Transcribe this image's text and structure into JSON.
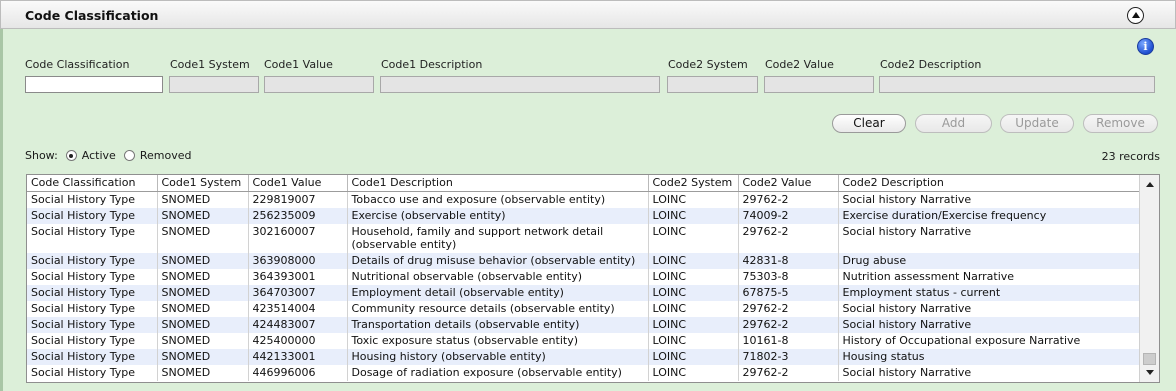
{
  "panel": {
    "title": "Code Classification"
  },
  "form": {
    "labels": {
      "code_classification": "Code Classification",
      "code1_system": "Code1 System",
      "code1_value": "Code1 Value",
      "code1_description": "Code1 Description",
      "code2_system": "Code2 System",
      "code2_value": "Code2 Value",
      "code2_description": "Code2 Description"
    },
    "values": {
      "code_classification": "",
      "code1_system": "",
      "code1_value": "",
      "code1_description": "",
      "code2_system": "",
      "code2_value": "",
      "code2_description": ""
    }
  },
  "buttons": {
    "clear": "Clear",
    "add": "Add",
    "update": "Update",
    "remove": "Remove"
  },
  "filter": {
    "show_label": "Show:",
    "active_label": "Active",
    "removed_label": "Removed",
    "selected": "Active"
  },
  "records_count": "23 records",
  "grid": {
    "columns": [
      "Code Classification",
      "Code1 System",
      "Code1 Value",
      "Code1 Description",
      "Code2 System",
      "Code2 Value",
      "Code2 Description"
    ],
    "rows": [
      [
        "Social History Type",
        "SNOMED",
        "229819007",
        "Tobacco use and exposure (observable entity)",
        "LOINC",
        "29762-2",
        "Social history Narrative"
      ],
      [
        "Social History Type",
        "SNOMED",
        "256235009",
        "Exercise (observable entity)",
        "LOINC",
        "74009-2",
        "Exercise duration/Exercise frequency"
      ],
      [
        "Social History Type",
        "SNOMED",
        "302160007",
        "Household, family and support network detail (observable entity)",
        "LOINC",
        "29762-2",
        "Social history Narrative"
      ],
      [
        "Social History Type",
        "SNOMED",
        "363908000",
        "Details of drug misuse behavior (observable entity)",
        "LOINC",
        "42831-8",
        "Drug abuse"
      ],
      [
        "Social History Type",
        "SNOMED",
        "364393001",
        "Nutritional observable (observable entity)",
        "LOINC",
        "75303-8",
        "Nutrition assessment Narrative"
      ],
      [
        "Social History Type",
        "SNOMED",
        "364703007",
        "Employment detail (observable entity)",
        "LOINC",
        "67875-5",
        "Employment status - current"
      ],
      [
        "Social History Type",
        "SNOMED",
        "423514004",
        "Community resource details (observable entity)",
        "LOINC",
        "29762-2",
        "Social history Narrative"
      ],
      [
        "Social History Type",
        "SNOMED",
        "424483007",
        "Transportation details (observable entity)",
        "LOINC",
        "29762-2",
        "Social history Narrative"
      ],
      [
        "Social History Type",
        "SNOMED",
        "425400000",
        "Toxic exposure status (observable entity)",
        "LOINC",
        "10161-8",
        "History of Occupational exposure Narrative"
      ],
      [
        "Social History Type",
        "SNOMED",
        "442133001",
        "Housing history (observable entity)",
        "LOINC",
        "71802-3",
        "Housing status"
      ],
      [
        "Social History Type",
        "SNOMED",
        "446996006",
        "Dosage of radiation exposure (observable entity)",
        "LOINC",
        "29762-2",
        "Social history Narrative"
      ]
    ]
  },
  "icons": {
    "collapse": "chevron-up-circle-icon",
    "info": "info-icon"
  }
}
